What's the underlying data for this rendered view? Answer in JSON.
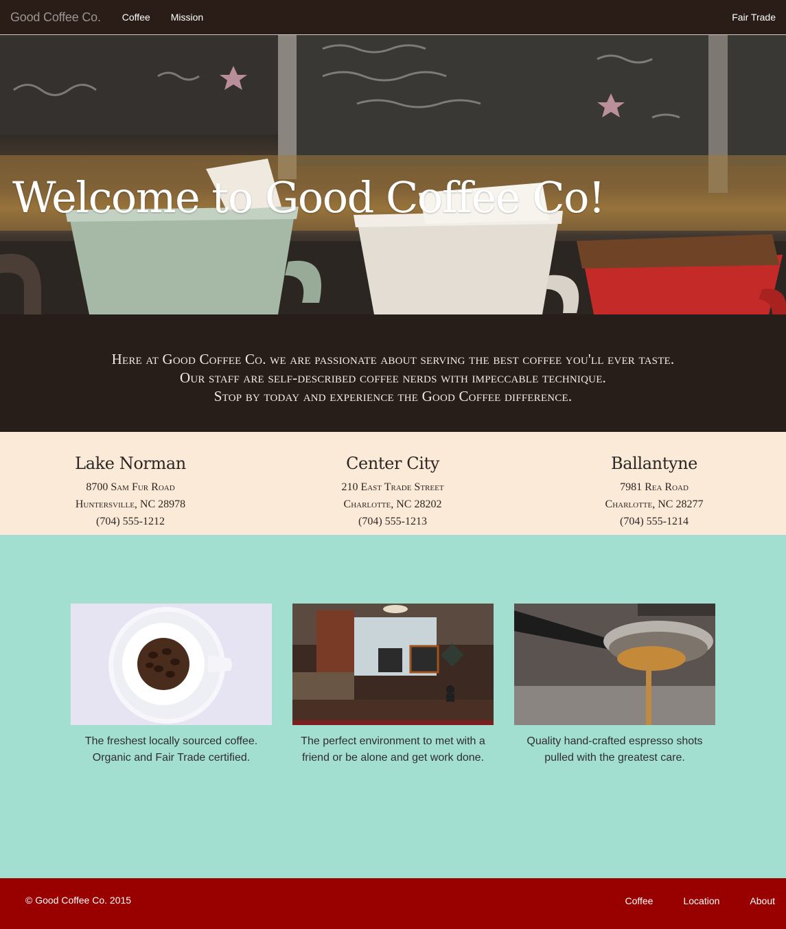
{
  "navbar": {
    "brand": "Good Coffee Co.",
    "links": [
      "Coffee",
      "Mission"
    ],
    "right_link": "Fair Trade"
  },
  "hero": {
    "title": "Welcome to Good Coffee Co!"
  },
  "intro": {
    "lines": [
      "Here at Good Coffee Co. we are passionate about serving the best coffee you'll ever taste.",
      "Our staff are self-described coffee nerds with impeccable technique.",
      "Stop by today and experience the Good Coffee difference."
    ]
  },
  "locations": [
    {
      "name": "Lake Norman",
      "street": "8700 Sam Fur Road",
      "city": "Huntersville, NC 28978",
      "phone": "(704) 555-1212"
    },
    {
      "name": "Center City",
      "street": "210 East Trade Street",
      "city": "Charlotte, NC 28202",
      "phone": "(704) 555-1213"
    },
    {
      "name": "Ballantyne",
      "street": "7981 Rea Road",
      "city": "Charlotte, NC 28277",
      "phone": "(704) 555-1214"
    }
  ],
  "features": [
    {
      "line1": "The freshest locally sourced coffee.",
      "line2": "Organic and Fair Trade certified."
    },
    {
      "line1": "The perfect environment to met with a",
      "line2": "friend or be alone and get work done."
    },
    {
      "line1": "Quality hand-crafted espresso shots",
      "line2": "pulled with the greatest care."
    }
  ],
  "footer": {
    "copyright": "© Good Coffee Co. 2015",
    "links": [
      "Coffee",
      "Location",
      "About"
    ]
  },
  "colors": {
    "nav_bg": "#2a1d18",
    "intro_bg": "#271d19",
    "locations_bg": "#fbead8",
    "features_bg": "#a3dfd0",
    "footer_bg": "#990000"
  }
}
